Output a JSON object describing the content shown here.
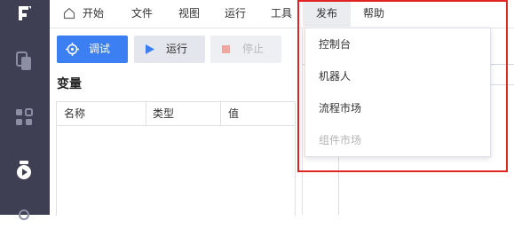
{
  "menubar": {
    "home": "开始",
    "file": "文件",
    "view": "视图",
    "run": "运行",
    "tools": "工具",
    "publish": "发布",
    "help": "帮助"
  },
  "toolbar": {
    "debug": "调试",
    "run": "运行",
    "stop": "停止"
  },
  "variables": {
    "title": "变量",
    "columns": [
      "名称",
      "类型",
      "值"
    ]
  },
  "publish_menu": {
    "items": [
      {
        "label": "控制台",
        "disabled": false
      },
      {
        "label": "机器人",
        "disabled": false
      },
      {
        "label": "流程市场",
        "disabled": false
      },
      {
        "label": "组件市场",
        "disabled": true
      }
    ]
  },
  "colors": {
    "rail": "#3e3f52",
    "primary": "#3b7ff2",
    "stop_icon": "#f0a79f",
    "annotation": "#e02424"
  }
}
